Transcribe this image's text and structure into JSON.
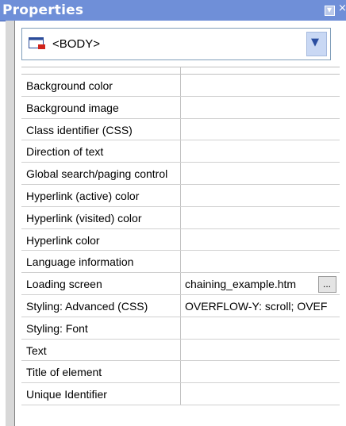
{
  "window": {
    "title": "Properties"
  },
  "selector": {
    "value": "<BODY>",
    "icon": "element-icon"
  },
  "properties": [
    {
      "name": "Background color",
      "value": ""
    },
    {
      "name": "Background image",
      "value": ""
    },
    {
      "name": "Class identifier (CSS)",
      "value": ""
    },
    {
      "name": "Direction of text",
      "value": ""
    },
    {
      "name": "Global search/paging control",
      "value": ""
    },
    {
      "name": "Hyperlink (active) color",
      "value": ""
    },
    {
      "name": "Hyperlink (visited) color",
      "value": ""
    },
    {
      "name": "Hyperlink color",
      "value": ""
    },
    {
      "name": "Language information",
      "value": ""
    },
    {
      "name": "Loading screen",
      "value": "chaining_example.htm",
      "has_browse_button": true,
      "browse_label": "..."
    },
    {
      "name": "Styling: Advanced (CSS)",
      "value": "OVERFLOW-Y: scroll; OVEF"
    },
    {
      "name": "Styling: Font",
      "value": ""
    },
    {
      "name": "Text",
      "value": ""
    },
    {
      "name": "Title of element",
      "value": ""
    },
    {
      "name": "Unique Identifier",
      "value": ""
    }
  ]
}
